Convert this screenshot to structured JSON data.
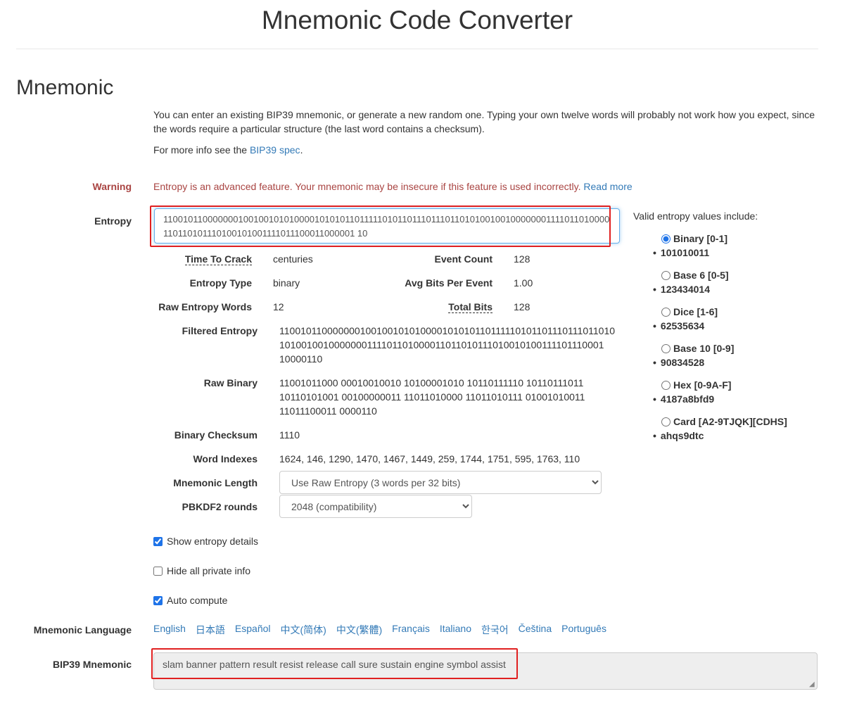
{
  "header": {
    "title": "Mnemonic Code Converter"
  },
  "section": {
    "title": "Mnemonic",
    "intro_line1": "You can enter an existing BIP39 mnemonic, or generate a new random one. Typing your own twelve words will probably not work how you expect, since",
    "intro_line2": "the words require a particular structure (the last word contains a checksum).",
    "more_info_prefix": "For more info see the ",
    "more_info_link": "BIP39 spec",
    "more_info_suffix": "."
  },
  "warning": {
    "label": "Warning",
    "text": "Entropy is an advanced feature. Your mnemonic may be insecure if this feature is used incorrectly.",
    "read_more": "Read more"
  },
  "entropy": {
    "label": "Entropy",
    "value": "110010110000000100100101010000101010110111110101101110111011010100100100000001111011010000110110101110100101001111011100011000001 10"
  },
  "details": {
    "time_to_crack_label": "Time To Crack",
    "time_to_crack": "centuries",
    "event_count_label": "Event Count",
    "event_count": "128",
    "entropy_type_label": "Entropy Type",
    "entropy_type": "binary",
    "avg_bits_label": "Avg Bits Per Event",
    "avg_bits": "1.00",
    "raw_words_label": "Raw Entropy Words",
    "raw_words": "12",
    "total_bits_label": "Total Bits",
    "total_bits": "128",
    "filtered_label": "Filtered Entropy",
    "filtered_l1": "110010110000000100100101010000101010110111110101101110111011010",
    "filtered_l2": "1010010010000000111101101000011011010111010010100111101110001",
    "filtered_l3": "10000110",
    "raw_binary_label": "Raw Binary",
    "raw_binary_l1": "11001011000 00010010010 10100001010 10110111110 10110111011",
    "raw_binary_l2": "10110101001 00100000011 11011010000 11011010111 01001010011",
    "raw_binary_l3": "11011100011 0000110",
    "checksum_label": "Binary Checksum",
    "checksum": "1110",
    "indexes_label": "Word Indexes",
    "indexes": "1624, 146, 1290, 1470, 1467, 1449, 259, 1744, 1751, 595, 1763, 110",
    "length_label": "Mnemonic Length",
    "length_value": "Use Raw Entropy (3 words per 32 bits)",
    "pbkdf2_label": "PBKDF2 rounds",
    "pbkdf2_value": "2048 (compatibility)"
  },
  "options": {
    "show_entropy": "Show entropy details",
    "hide_private": "Hide all private info",
    "auto_compute": "Auto compute"
  },
  "language": {
    "label": "Mnemonic Language",
    "items": [
      "English",
      "日本語",
      "Español",
      "中文(简体)",
      "中文(繁體)",
      "Français",
      "Italiano",
      "한국어",
      "Čeština",
      "Português"
    ]
  },
  "bip39": {
    "label": "BIP39 Mnemonic",
    "value": "slam banner pattern result resist release call sure sustain engine symbol assist"
  },
  "valid_entropy": {
    "title": "Valid entropy values include:",
    "options": [
      {
        "label": "Binary [0-1]",
        "example": "101010011",
        "checked": true
      },
      {
        "label": "Base 6 [0-5]",
        "example": "123434014",
        "checked": false
      },
      {
        "label": "Dice [1-6]",
        "example": "62535634",
        "checked": false
      },
      {
        "label": "Base 10 [0-9]",
        "example": "90834528",
        "checked": false
      },
      {
        "label": "Hex [0-9A-F]",
        "example": "4187a8bfd9",
        "checked": false
      },
      {
        "label": "Card [A2-9TJQK][CDHS]",
        "example": "ahqs9dtc",
        "checked": false
      }
    ]
  },
  "colors": {
    "link": "#337ab7",
    "warning": "#a94442",
    "highlight": "#e02020"
  }
}
